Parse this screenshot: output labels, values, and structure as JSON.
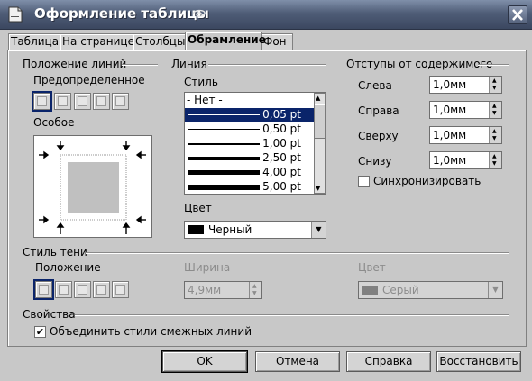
{
  "window": {
    "title": "Оформление таблицы"
  },
  "tabs": [
    "Таблица",
    "На странице",
    "Столбцы",
    "Обрамление",
    "Фон"
  ],
  "line_arrangement": {
    "title": "Положение линий",
    "default_label": "Предопределенное",
    "user_defined_label": "Особое"
  },
  "line": {
    "title": "Линия",
    "style_label": "Стиль",
    "styles": [
      "- Нет -",
      "0,05 pt",
      "0,50 pt",
      "1,00 pt",
      "2,50 pt",
      "4,00 pt",
      "5,00 pt"
    ],
    "selected_index": 1,
    "color_label": "Цвет",
    "color_value": "Черный",
    "color_swatch": "#000000"
  },
  "spacing": {
    "title": "Отступы от содержимого",
    "left_label": "Слева",
    "left_value": "1,0мм",
    "right_label": "Справа",
    "right_value": "1,0мм",
    "top_label": "Сверху",
    "top_value": "1,0мм",
    "bottom_label": "Снизу",
    "bottom_value": "1,0мм",
    "sync_label": "Синхронизировать",
    "sync_checked": false
  },
  "shadow": {
    "title": "Стиль тени",
    "position_label": "Положение",
    "width_label": "Ширина",
    "width_value": "4,9мм",
    "color_label": "Цвет",
    "color_value": "Серый",
    "color_swatch": "#808080"
  },
  "properties": {
    "title": "Свойства",
    "merge_label": "Объединить стили смежных линий",
    "merge_checked": true
  },
  "buttons": {
    "ok": "OK",
    "cancel": "Отмена",
    "help": "Справка",
    "reset": "Восстановить"
  },
  "colors": {
    "accent": "#0a246a",
    "titlebar": "#4f5d77",
    "face": "#c8c8c8"
  }
}
